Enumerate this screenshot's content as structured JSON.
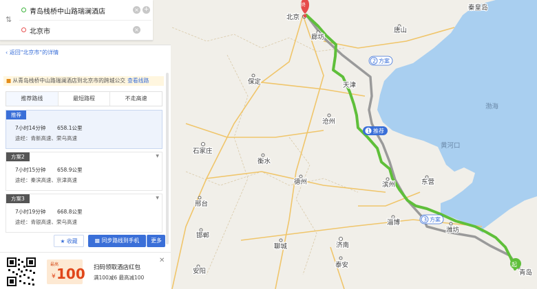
{
  "search": {
    "origin": "青岛栈桥中山路瑞澜酒店",
    "destination": "北京市"
  },
  "detail": {
    "back_link": "返回\"北京市\"的详情",
    "bus_tip": "从青岛栈桥中山路瑞澜酒店到北京市的跨城公交",
    "bus_tip_link": "查看线路"
  },
  "tabs": [
    "推荐路线",
    "最短路程",
    "不走高速"
  ],
  "plans": [
    {
      "tag": "推荐",
      "time": "7小时14分钟",
      "distance": "658.1公里",
      "via": "途经：青新高速、荣乌高速"
    },
    {
      "tag": "方案2",
      "time": "7小时15分钟",
      "distance": "658.9公里",
      "via": "途经：秦滨高速、京津高速"
    },
    {
      "tag": "方案3",
      "time": "7小时19分钟",
      "distance": "668.8公里",
      "via": "途经：青银高速、荣乌高速"
    }
  ],
  "actions": {
    "favorite": "收藏",
    "sync": "同步路线到手机",
    "more": "更多"
  },
  "promo": {
    "coupon_top": "最高",
    "coupon_currency": "¥",
    "coupon_amount": "100",
    "line1": "扫码领取酒店红包",
    "line2": "满100减6 最高减100"
  },
  "map": {
    "end_marker": "终",
    "start_marker": "起",
    "route_badges": {
      "rec": "推荐",
      "p2": "方案",
      "p3": "方案"
    },
    "badge_numbers": {
      "rec": "1",
      "p2": "2",
      "p3": "3"
    },
    "places": {
      "beijing": "北京",
      "langfang": "廊坊",
      "tianjin": "天津",
      "tangshan": "唐山",
      "qinhuangdao": "秦皇岛",
      "baoding": "保定",
      "cangzhou": "沧州",
      "shijiazhuang": "石家庄",
      "hengshui": "衡水",
      "dezhou": "德州",
      "binzhou": "滨州",
      "dongying": "东营",
      "zibo": "淄博",
      "weifang": "潍坊",
      "qingdao": "青岛",
      "xingtai": "邢台",
      "handan": "邯郸",
      "liaocheng": "聊城",
      "jinan": "济南",
      "taian": "泰安",
      "anyang": "安阳",
      "bohai": "渤海",
      "huanghekou": "黄河口"
    }
  },
  "colors": {
    "route_recommended": "#5fbf3a",
    "route_alt": "#9a9a9a",
    "sea": "#a9cff0",
    "land": "#f1efe9",
    "accent": "#3a6fd8"
  }
}
